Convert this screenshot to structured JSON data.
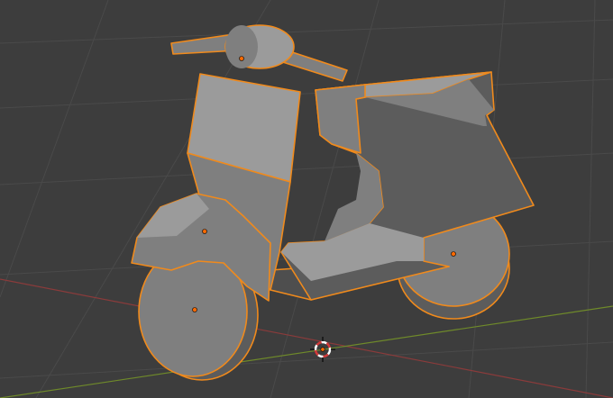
{
  "viewport": {
    "type": "blender-3d-viewport",
    "background_color": "#3d3d3d",
    "grid_color": "#4a4a4a",
    "x_axis_color": "#8a3b3b",
    "y_axis_color": "#6f8a2a"
  },
  "selection": {
    "outline_color": "#f08a1c",
    "active_outline_color": "#ffaa40",
    "origin_color": "#ff6a00"
  },
  "object": {
    "name": "scooter",
    "shading": "solid",
    "colors": {
      "light_face": "#9b9b9b",
      "mid_face": "#7f7f7f",
      "dark_face": "#5c5c5c",
      "shadow_face": "#4e4e4e"
    }
  },
  "cursor_3d": {
    "icon": "3d-cursor-icon",
    "ring_color_a": "#ffffff",
    "ring_color_b": "#d23a3a"
  }
}
